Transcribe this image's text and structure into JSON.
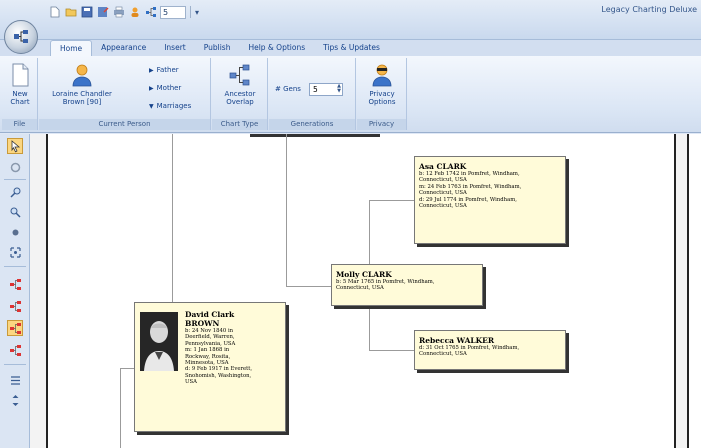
{
  "app": {
    "title": "Legacy Charting Deluxe"
  },
  "qat": {
    "generations_value": "5"
  },
  "tabs": [
    {
      "label": "Home",
      "active": true
    },
    {
      "label": "Appearance",
      "active": false
    },
    {
      "label": "Insert",
      "active": false
    },
    {
      "label": "Publish",
      "active": false
    },
    {
      "label": "Help & Options",
      "active": false
    },
    {
      "label": "Tips & Updates",
      "active": false
    }
  ],
  "ribbon": {
    "file": {
      "group_label": "File",
      "new_label_1": "New",
      "new_label_2": "Chart"
    },
    "current_person": {
      "group_label": "Current Person",
      "person_label_1": "Loraine Chandler",
      "person_label_2": "Brown [90]",
      "father": "Father",
      "mother": "Mother",
      "marriages": "Marriages"
    },
    "chart_type": {
      "group_label": "Chart Type",
      "label_1": "Ancestor",
      "label_2": "Overlap"
    },
    "generations": {
      "group_label": "Generations",
      "label": "# Gens",
      "value": "5"
    },
    "privacy": {
      "group_label": "Privacy",
      "label_1": "Privacy",
      "label_2": "Options"
    }
  },
  "chart": {
    "boxes": [
      {
        "name_1": "David Clark",
        "name_2": "BROWN",
        "details": [
          "b: 24 Nov 1840 in",
          "Deerfield, Warren,",
          "Pennsylvania, USA",
          "m: 1 Jan 1868 in",
          "Rockway, Rosita,",
          "Minnesota, USA",
          "d: 9 Feb 1917 in Everett,",
          "Snohomish, Washington,",
          "USA"
        ]
      },
      {
        "name_1": "Molly CLARK",
        "details": [
          "b: 5 Mar 1765 in Pomfret, Windham,",
          "Connecticut, USA"
        ]
      },
      {
        "name_1": "Asa CLARK",
        "details": [
          "b: 12 Feb 1742 in Pomfret, Windham,",
          "Connecticut, USA",
          "m: 24 Feb 1763 in Pomfret, Windham,",
          "Connecticut, USA",
          "d: 29 Jul 1774 in Pomfret, Windham,",
          "Connecticut, USA"
        ]
      },
      {
        "name_1": "Rebecca WALKER",
        "details": [
          "d: 31 Oct 1765 in Pomfret, Windham,",
          "Connecticut, USA"
        ]
      }
    ]
  },
  "colors": {
    "ribbon_text": "#15428b",
    "box_fill": "#fffbd9",
    "selected_tool": "#fbd681"
  }
}
